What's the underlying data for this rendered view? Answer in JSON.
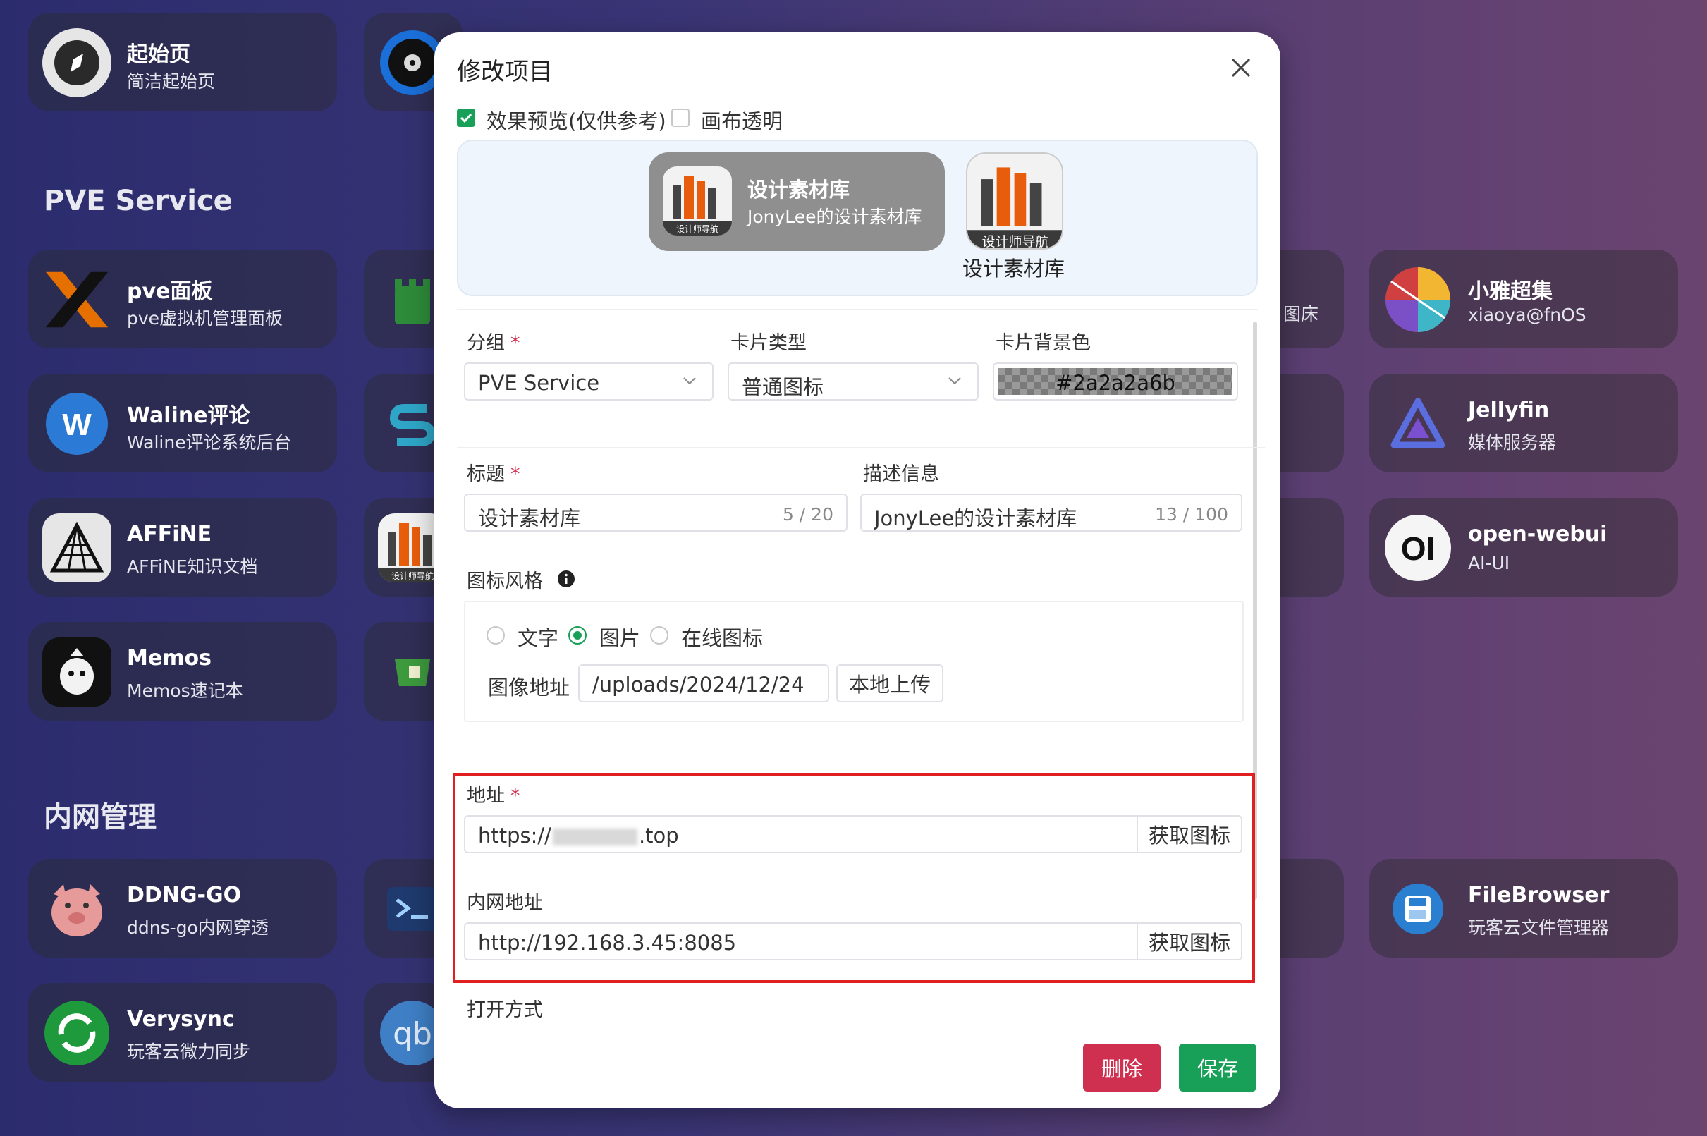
{
  "sections": {
    "pve": "PVE Service",
    "intranet": "内网管理"
  },
  "cards": {
    "start": {
      "title": "起始页",
      "desc": "简洁起始页"
    },
    "pve": {
      "title": "pve面板",
      "desc": "pve虚拟机管理面板"
    },
    "waline": {
      "title": "Waline评论",
      "desc": "Waline评论系统后台"
    },
    "affine": {
      "title": "AFFiNE",
      "desc": "AFFiNE知识文档"
    },
    "memos": {
      "title": "Memos",
      "desc": "Memos速记本"
    },
    "ddng": {
      "title": "DDNG-GO",
      "desc": "ddns-go内网穿透"
    },
    "verysync": {
      "title": "Verysync",
      "desc": "玩客云微力同步"
    },
    "xiaoya": {
      "title": "小雅超集",
      "desc": "xiaoya@fnOS"
    },
    "jellyfin": {
      "title": "Jellyfin",
      "desc": "媒体服务器"
    },
    "openwebui": {
      "title": "open-webui",
      "desc": "AI-UI"
    },
    "filebrowser": {
      "title": "FileBrowser",
      "desc": "玩客云文件管理器"
    },
    "partial_fragment": "图床",
    "design_icon_text": "设计师导航",
    "openwebui_logo": "OI",
    "qb_logo": "qb"
  },
  "modal": {
    "title": "修改项目",
    "preview_checkbox": "效果预览(仅供参考)",
    "transparent_checkbox": "画布透明",
    "preview": {
      "card_title": "设计素材库",
      "card_desc": "JonyLee的设计素材库",
      "icon_text": "设计师导航",
      "small_label": "设计素材库"
    },
    "group": {
      "label": "分组",
      "value": "PVE Service"
    },
    "card_type": {
      "label": "卡片类型",
      "value": "普通图标"
    },
    "card_bg": {
      "label": "卡片背景色",
      "value": "#2a2a2a6b"
    },
    "title_field": {
      "label": "标题",
      "value": "设计素材库",
      "count": "5 / 20"
    },
    "desc_field": {
      "label": "描述信息",
      "value": "JonyLee的设计素材库",
      "count": "13 / 100"
    },
    "icon_style": {
      "label": "图标风格",
      "options": [
        "文字",
        "图片",
        "在线图标"
      ],
      "selected": "图片",
      "image_url_label": "图像地址",
      "image_url": "/uploads/2024/12/24",
      "upload_button": "本地上传"
    },
    "address": {
      "label": "地址",
      "value_prefix": "https://",
      "value_suffix": ".top",
      "fetch_button": "获取图标"
    },
    "intranet_address": {
      "label": "内网地址",
      "value": "http://192.168.3.45:8085",
      "fetch_button": "获取图标"
    },
    "open_mode": {
      "label": "打开方式"
    },
    "required_mark": "*",
    "delete_button": "删除",
    "save_button": "保存"
  },
  "colors": {
    "accent_green": "#18a058",
    "danger_red": "#d03050",
    "highlight_box": "#e02020"
  }
}
